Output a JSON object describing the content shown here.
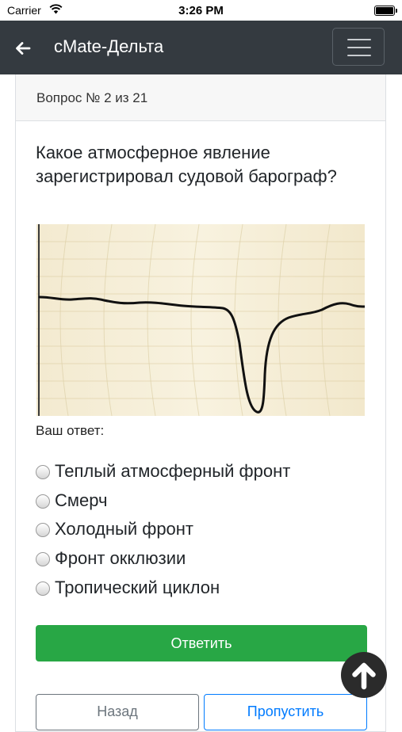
{
  "status_bar": {
    "carrier": "Carrier",
    "time": "3:26 PM"
  },
  "navbar": {
    "title": "cMate-Дельта",
    "back_icon": "arrow-left-icon",
    "menu_icon": "hamburger-icon"
  },
  "card": {
    "header": "Вопрос № 2 из 21"
  },
  "question": {
    "text": "Какое атмосферное явление зарегистрировал судовой барограф?"
  },
  "figure": {
    "description_icon": "barograph-chart-image"
  },
  "answer": {
    "label": "Ваш ответ:",
    "options": [
      {
        "label": "Теплый атмосферный фронт",
        "selected": false
      },
      {
        "label": "Смерч",
        "selected": false
      },
      {
        "label": "Холодный фронт",
        "selected": false
      },
      {
        "label": "Фронт окклюзии",
        "selected": false
      },
      {
        "label": "Тропический циклон",
        "selected": false
      }
    ]
  },
  "buttons": {
    "submit": "Ответить",
    "back": "Назад",
    "skip": "Пропустить"
  },
  "colors": {
    "navbar": "#343a40",
    "submit": "#28a745",
    "skip": "#007bff",
    "back": "#6c757d"
  },
  "scroll_top_icon": "arrow-up-icon"
}
